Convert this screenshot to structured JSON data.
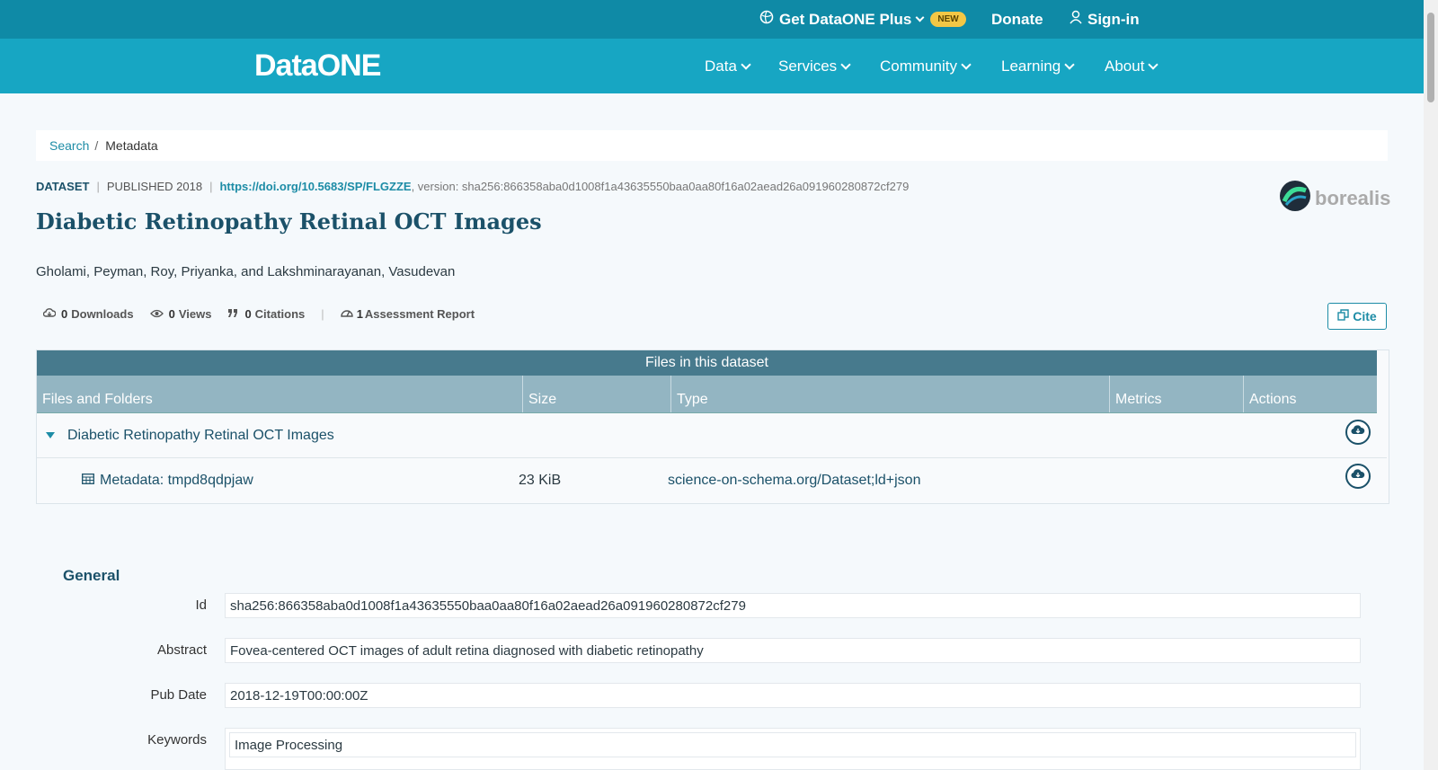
{
  "topbar": {
    "plus_label": "Get DataONE Plus",
    "new_badge": "NEW",
    "donate_label": "Donate",
    "signin_label": "Sign-in"
  },
  "navbar": {
    "logo_text": "DataONE",
    "items": [
      {
        "label": "Data"
      },
      {
        "label": "Services"
      },
      {
        "label": "Community"
      },
      {
        "label": "Learning"
      },
      {
        "label": "About"
      }
    ]
  },
  "breadcrumb": {
    "search": "Search",
    "separator": "/",
    "current": "Metadata"
  },
  "dataset": {
    "type_label": "DATASET",
    "published": "PUBLISHED 2018",
    "doi": "https://doi.org/10.5683/SP/FLGZZE",
    "version": ", version: sha256:866358aba0d1008f1a43635550baa0aa80f16a02aead26a091960280872cf279",
    "title": "Diabetic Retinopathy Retinal OCT Images",
    "authors": "Gholami, Peyman, Roy, Priyanka, and Lakshminarayanan, Vasudevan",
    "repository_logo": "borealis"
  },
  "metrics": {
    "downloads_count": "0",
    "downloads_label": "Downloads",
    "views_count": "0",
    "views_label": "Views",
    "citations_count": "0",
    "citations_label": "Citations",
    "assessment_count": "1",
    "assessment_label": "Assessment Report"
  },
  "cite_label": "Cite",
  "files_table": {
    "caption": "Files in this dataset",
    "columns": [
      "Files and Folders",
      "Size",
      "Type",
      "Metrics",
      "Actions"
    ],
    "folder_name": "Diabetic Retinopathy Retinal OCT Images",
    "file": {
      "name": "Metadata: tmpd8qdpjaw",
      "size": "23 KiB",
      "type": "science-on-schema.org/Dataset;ld+json"
    }
  },
  "general": {
    "heading": "General",
    "fields": [
      {
        "label": "Id",
        "value": "sha256:866358aba0d1008f1a43635550baa0aa80f16a02aead26a091960280872cf279"
      },
      {
        "label": "Abstract",
        "value": "Fovea-centered OCT images of adult retina diagnosed with diabetic retinopathy"
      },
      {
        "label": "Pub Date",
        "value": "2018-12-19T00:00:00Z"
      },
      {
        "label": "Keywords",
        "value": "Image Processing"
      }
    ]
  },
  "colors": {
    "topbar": "#0f8aa6",
    "navbar": "#17a6c3",
    "title": "#1b5169",
    "table_caption": "#477a8d",
    "table_header": "#93b5c2"
  }
}
